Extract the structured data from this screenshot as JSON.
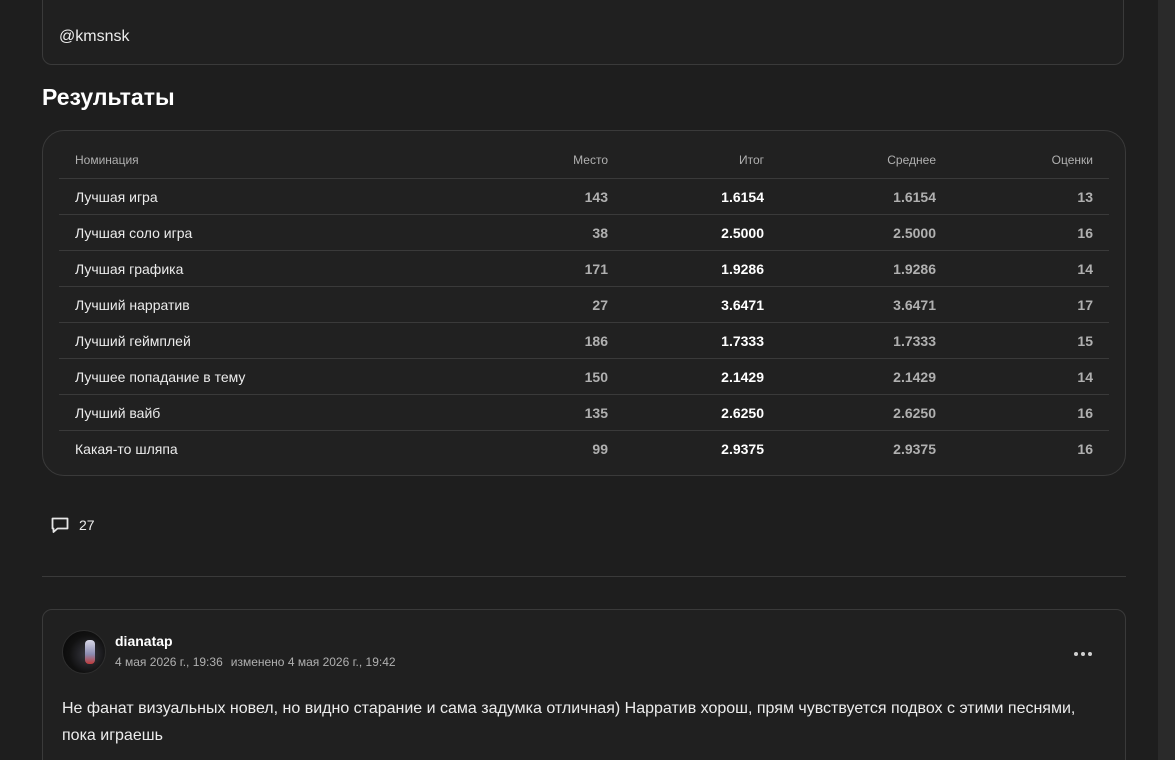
{
  "top_card": {
    "handle": "@kmsnsk"
  },
  "results": {
    "title": "Результаты",
    "columns": {
      "name": "Номинация",
      "place": "Место",
      "total": "Итог",
      "average": "Среднее",
      "votes": "Оценки"
    },
    "rows": [
      {
        "name": "Лучшая игра",
        "place": "143",
        "total": "1.6154",
        "average": "1.6154",
        "votes": "13"
      },
      {
        "name": "Лучшая соло игра",
        "place": "38",
        "total": "2.5000",
        "average": "2.5000",
        "votes": "16"
      },
      {
        "name": "Лучшая графика",
        "place": "171",
        "total": "1.9286",
        "average": "1.9286",
        "votes": "14"
      },
      {
        "name": "Лучший нарратив",
        "place": "27",
        "total": "3.6471",
        "average": "3.6471",
        "votes": "17"
      },
      {
        "name": "Лучший геймплей",
        "place": "186",
        "total": "1.7333",
        "average": "1.7333",
        "votes": "15"
      },
      {
        "name": "Лучшее попадание в тему",
        "place": "150",
        "total": "2.1429",
        "average": "2.1429",
        "votes": "14"
      },
      {
        "name": "Лучший вайб",
        "place": "135",
        "total": "2.6250",
        "average": "2.6250",
        "votes": "16"
      },
      {
        "name": "Какая-то шляпа",
        "place": "99",
        "total": "2.9375",
        "average": "2.9375",
        "votes": "16"
      }
    ]
  },
  "comments": {
    "icon": "comment-bubble-icon",
    "count": "27"
  },
  "comment": {
    "author": "dianatap",
    "posted": "4 мая 2026 г., 19:36",
    "edited": "изменено 4 мая 2026 г., 19:42",
    "more_icon": "more-dots-icon",
    "text": "Не фанат визуальных новел, но видно старание и сама задумка отличная) Нарратив хорош, прям чувствуется подвох с этими песнями, пока играешь"
  },
  "colors": {
    "background": "#1e1e1e",
    "card_border": "#3a3a3a",
    "text_primary": "#ffffff",
    "text_secondary": "#b0b0b0"
  }
}
